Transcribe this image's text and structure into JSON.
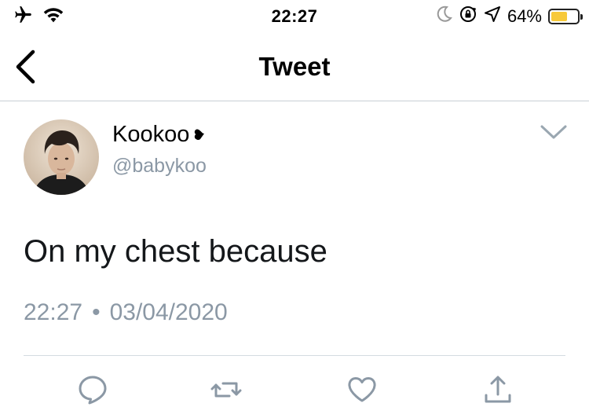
{
  "status_bar": {
    "time": "22:27",
    "battery_percent": "64%",
    "battery_level": 0.64,
    "battery_color": "#f7c93a",
    "icons": [
      "airplane-icon",
      "wifi-icon",
      "moon-icon",
      "orientation-lock-icon",
      "location-arrow-icon",
      "battery-icon"
    ]
  },
  "nav": {
    "title": "Tweet",
    "back_icon": "chevron-left-icon"
  },
  "tweet": {
    "author_name": "Kookoo",
    "author_suffix_icon": "heart-icon",
    "author_handle": "@babykoo",
    "text": "On my chest because",
    "time": "22:27",
    "separator": "•",
    "date": "03/04/2020"
  },
  "actions": [
    {
      "icon": "reply-icon"
    },
    {
      "icon": "retweet-icon"
    },
    {
      "icon": "like-icon"
    },
    {
      "icon": "share-icon"
    }
  ],
  "colors": {
    "text_primary": "#14171a",
    "text_secondary": "#8b98a5",
    "action_icon": "#8b98a5",
    "divider": "#d4dbe0"
  }
}
